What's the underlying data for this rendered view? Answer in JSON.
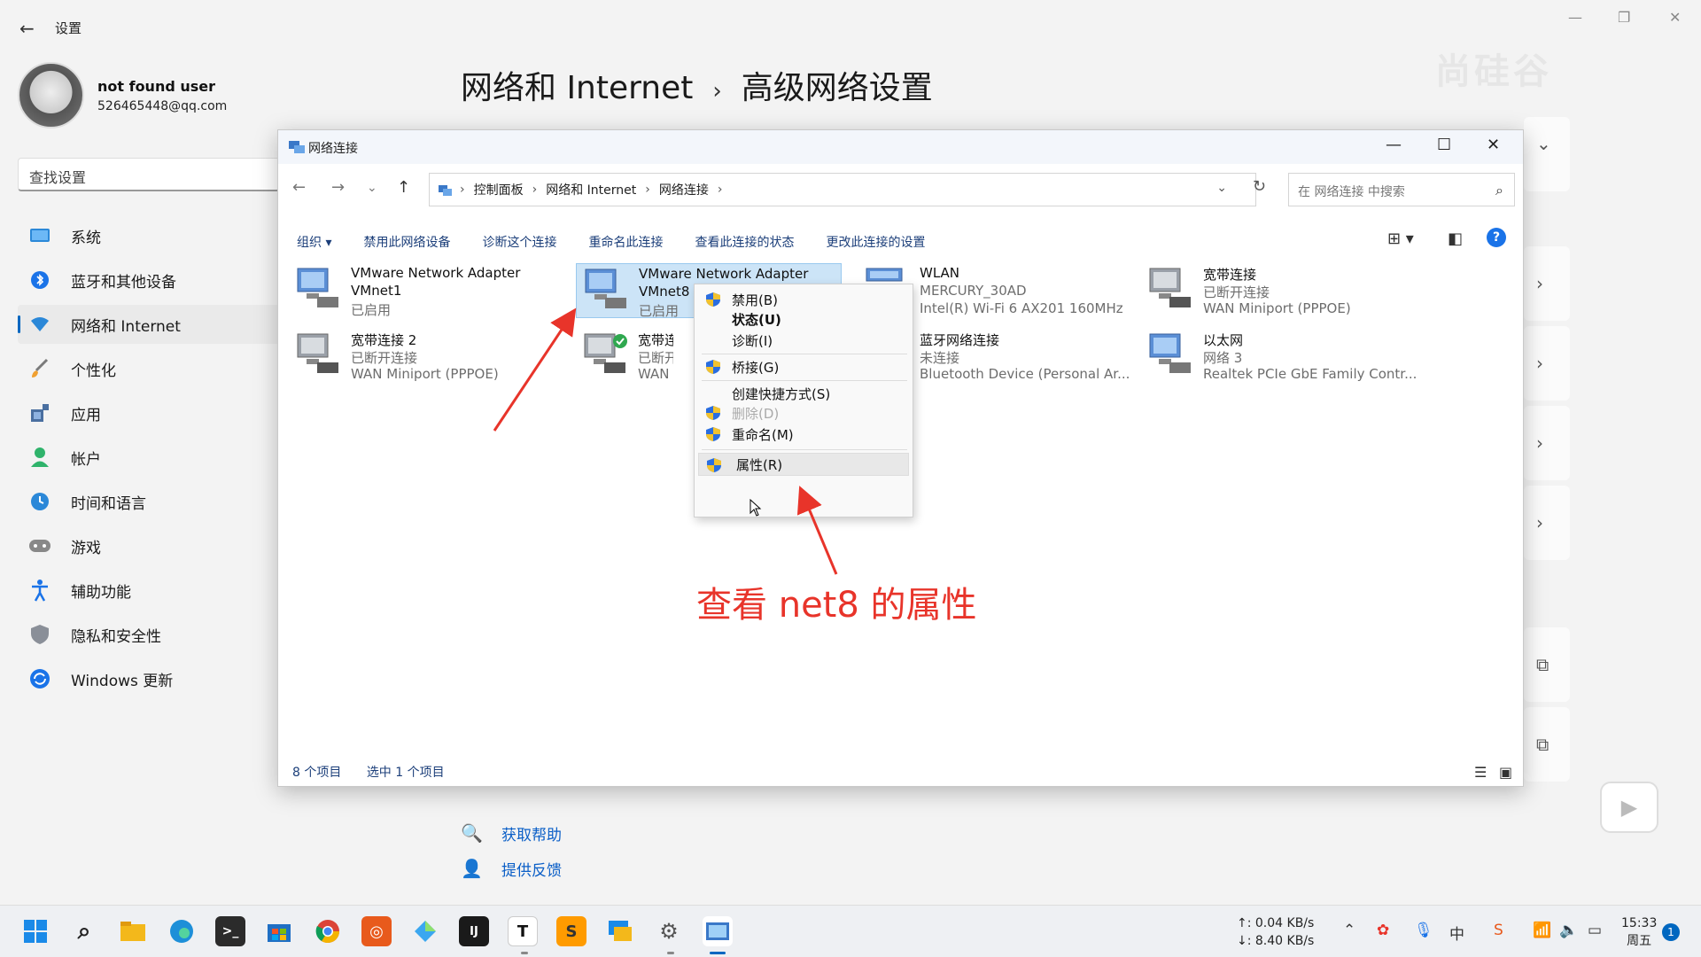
{
  "settings": {
    "window_title": "设置",
    "user": {
      "name": "not found user",
      "email": "526465448@qq.com"
    },
    "search_placeholder": "查找设置",
    "nav": [
      {
        "label": "系统",
        "icon": "monitor-icon"
      },
      {
        "label": "蓝牙和其他设备",
        "icon": "bluetooth-icon"
      },
      {
        "label": "网络和 Internet",
        "icon": "wifi-icon",
        "active": true
      },
      {
        "label": "个性化",
        "icon": "brush-icon"
      },
      {
        "label": "应用",
        "icon": "apps-icon"
      },
      {
        "label": "帐户",
        "icon": "person-icon"
      },
      {
        "label": "时间和语言",
        "icon": "clock-globe-icon"
      },
      {
        "label": "游戏",
        "icon": "gamepad-icon"
      },
      {
        "label": "辅助功能",
        "icon": "accessibility-icon"
      },
      {
        "label": "隐私和安全性",
        "icon": "shield-icon"
      },
      {
        "label": "Windows 更新",
        "icon": "update-icon"
      }
    ],
    "breadcrumb": {
      "parent": "网络和 Internet",
      "separator": "›",
      "current": "高级网络设置"
    },
    "help": {
      "get_help": "获取帮助",
      "feedback": "提供反馈"
    },
    "watermark": "尚硅谷"
  },
  "network_window": {
    "title": "网络连接",
    "address": [
      "控制面板",
      "网络和 Internet",
      "网络连接"
    ],
    "search_placeholder": "在 网络连接 中搜索",
    "commands": [
      "组织 ▾",
      "禁用此网络设备",
      "诊断这个连接",
      "重命名此连接",
      "查看此连接的状态",
      "更改此连接的设置"
    ],
    "items": [
      {
        "name": "VMware Network Adapter",
        "line2": "VMnet1",
        "status": "已启用"
      },
      {
        "name": "VMware Network Adapter",
        "line2": "VMnet8",
        "status": "已启用",
        "selected": true
      },
      {
        "name": "WLAN",
        "line2": "MERCURY_30AD",
        "status": "Intel(R) Wi-Fi 6 AX201 160MHz"
      },
      {
        "name": "宽带连接",
        "line2": "已断开连接",
        "status": "WAN Miniport (PPPOE)"
      },
      {
        "name": "宽带连接 2",
        "line2": "已断开连接",
        "status": "WAN Miniport (PPPOE)"
      },
      {
        "name": "宽带连接",
        "line2": "已断开连",
        "status": "WAN Mi"
      },
      {
        "name": "蓝牙网络连接",
        "line2": "未连接",
        "status": "Bluetooth Device (Personal Ar..."
      },
      {
        "name": "以太网",
        "line2": "网络 3",
        "status": "Realtek PCIe GbE Family Contr..."
      }
    ],
    "status": {
      "count": "8 个项目",
      "selected": "选中 1 个项目"
    }
  },
  "context_menu": {
    "items": [
      {
        "label": "禁用(B)",
        "shield": true
      },
      {
        "label": "状态(U)",
        "bold": true
      },
      {
        "label": "诊断(I)"
      },
      {
        "label": "桥接(G)",
        "shield": true
      },
      {
        "label": "创建快捷方式(S)"
      },
      {
        "label": "删除(D)",
        "shield": true,
        "disabled": true
      },
      {
        "label": "重命名(M)",
        "shield": true
      },
      {
        "label": "属性(R)",
        "shield": true,
        "hover": true
      }
    ]
  },
  "annotation": {
    "text": "查看 net8 的属性",
    "color": "#e8342a"
  },
  "taskbar": {
    "upload": "↑: 0.04 KB/s",
    "download": "↓: 8.40 KB/s",
    "time": "15:33",
    "day": "周五",
    "notifications": "1"
  },
  "colors": {
    "accent": "#0067c0",
    "selection": "#cce4f7",
    "link": "#0b5fc7"
  }
}
